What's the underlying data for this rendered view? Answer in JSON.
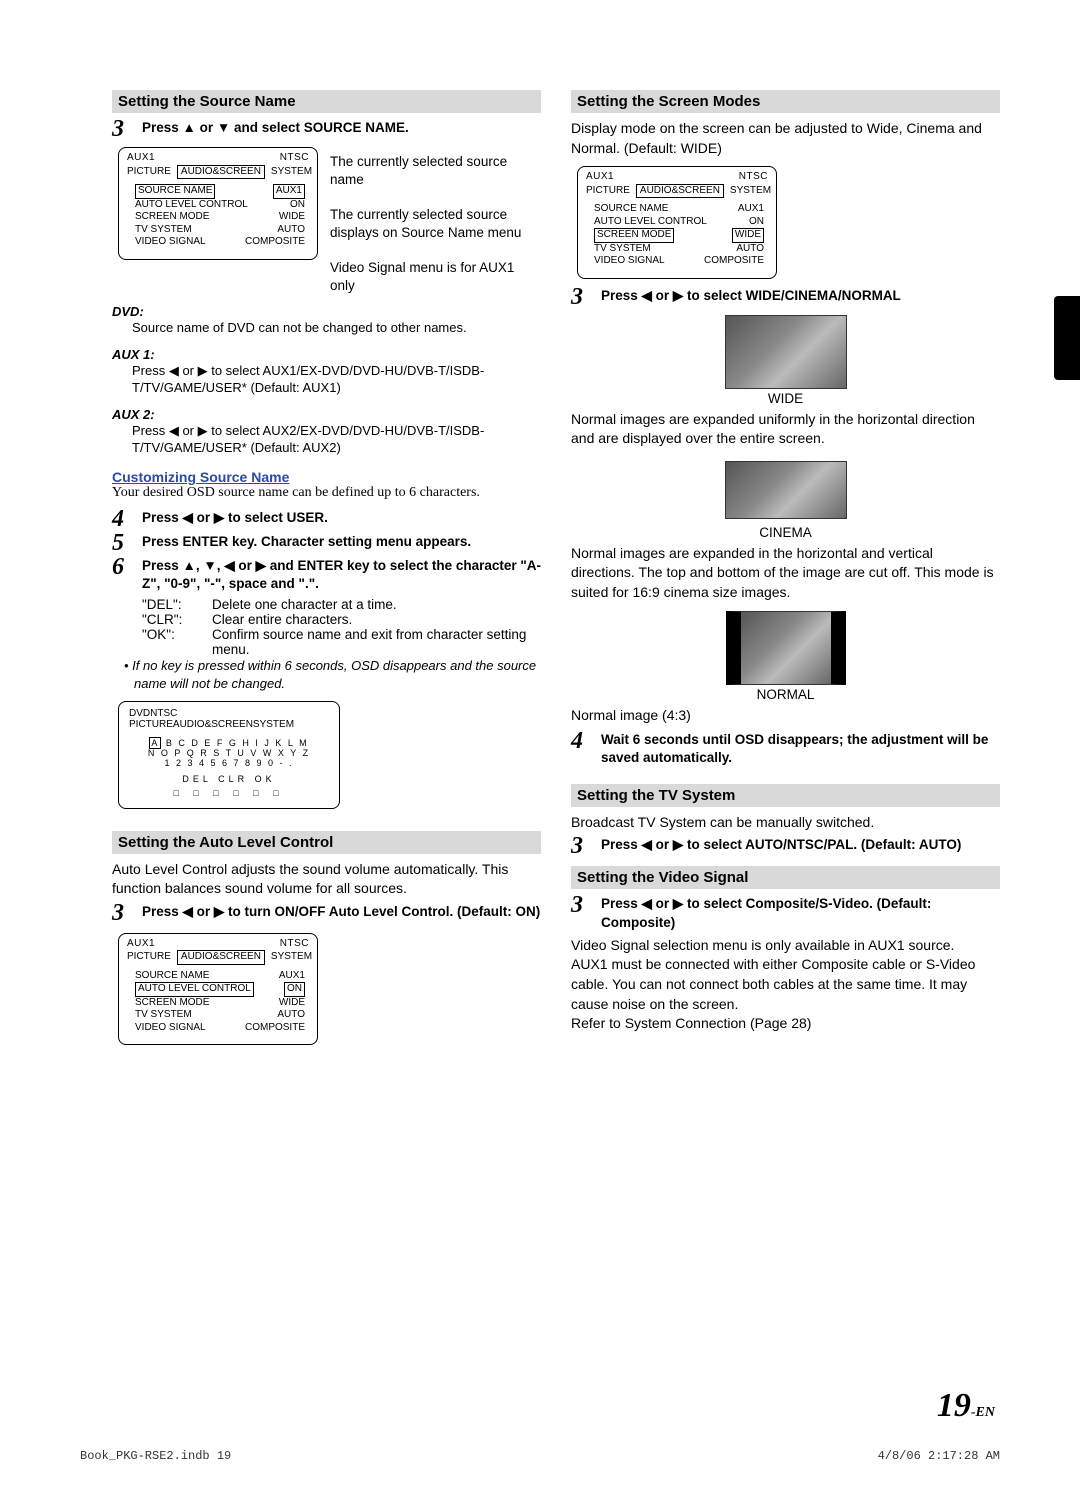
{
  "left": {
    "h1": "Setting the Source Name",
    "s3": "Press  ▲ or ▼ and select SOURCE NAME.",
    "osd1": {
      "title": "AUX1",
      "tv": "NTSC",
      "tabs": [
        "PICTURE",
        "AUDIO&SCREEN",
        "SYSTEM"
      ],
      "rows": [
        {
          "l": "SOURCE NAME",
          "r": "AUX1",
          "hlL": true,
          "hlR": true
        },
        {
          "l": "AUTO LEVEL CONTROL",
          "r": "ON"
        },
        {
          "l": "SCREEN MODE",
          "r": "WIDE"
        },
        {
          "l": "TV SYSTEM",
          "r": "AUTO"
        },
        {
          "l": "VIDEO SIGNAL",
          "r": "COMPOSITE"
        }
      ]
    },
    "cap1": "The currently selected source name",
    "cap2": "The currently selected source displays on Source Name menu",
    "cap3": "Video Signal menu is for AUX1 only",
    "dvd_h": "DVD:",
    "dvd_b": "Source name of DVD can not be changed to other names.",
    "aux1_h": "AUX 1:",
    "aux1_b": "Press ◀ or ▶ to select AUX1/EX-DVD/DVD-HU/DVB-T/ISDB-T/TV/GAME/USER* (Default: AUX1)",
    "aux2_h": "AUX 2:",
    "aux2_b": "Press ◀ or ▶ to select AUX2/EX-DVD/DVD-HU/DVB-T/ISDB-T/TV/GAME/USER* (Default: AUX2)",
    "cust_h": "Customizing Source Name",
    "cust_b": "Your desired OSD source name can be defined up to 6 characters.",
    "s4": "Press ◀ or ▶ to select USER.",
    "s5": "Press ENTER key. Character setting menu appears.",
    "s6": "Press ▲, ▼, ◀ or ▶ and ENTER key to select the character \"A-Z\", \"0-9\", \"-\", space and \".\".",
    "cmds": [
      {
        "k": "\"DEL\":",
        "v": "Delete one character at a time."
      },
      {
        "k": "\"CLR\":",
        "v": "Clear entire characters."
      },
      {
        "k": "\"OK\":",
        "v": "Confirm source name and exit from character setting menu."
      }
    ],
    "note": "If no key is pressed within 6 seconds, OSD disappears and the source name will not be changed.",
    "char_panel": {
      "title": "DVD",
      "tv": "NTSC",
      "tabs": [
        "PICTURE",
        "AUDIO&SCREEN",
        "SYSTEM"
      ],
      "line1": "A B C D E F G H I J K L M",
      "line2": "N O P Q R S T U V W X Y Z",
      "line3": "1 2 3 4 5 6 7 8 9 0 -   .",
      "ops": "DEL   CLR   OK",
      "slots": "□ □ □ □ □ □"
    },
    "h2": "Setting the Auto Level Control",
    "alc_b": "Auto Level Control adjusts the sound volume automatically. This function balances sound volume for all sources.",
    "alc_s3": "Press ◀ or ▶ to turn ON/OFF Auto Level Control. (Default: ON)",
    "osd2": {
      "title": "AUX1",
      "tv": "NTSC",
      "tabs": [
        "PICTURE",
        "AUDIO&SCREEN",
        "SYSTEM"
      ],
      "rows": [
        {
          "l": "SOURCE NAME",
          "r": "AUX1"
        },
        {
          "l": "AUTO LEVEL CONTROL",
          "r": "ON",
          "hlL": true,
          "hlR": true
        },
        {
          "l": "SCREEN MODE",
          "r": "WIDE"
        },
        {
          "l": "TV SYSTEM",
          "r": "AUTO"
        },
        {
          "l": "VIDEO SIGNAL",
          "r": "COMPOSITE"
        }
      ]
    }
  },
  "right": {
    "h1": "Setting the Screen Modes",
    "b1": "Display mode on the screen can be adjusted to Wide, Cinema and Normal. (Default: WIDE)",
    "osd": {
      "title": "AUX1",
      "tv": "NTSC",
      "tabs": [
        "PICTURE",
        "AUDIO&SCREEN",
        "SYSTEM"
      ],
      "rows": [
        {
          "l": "SOURCE NAME",
          "r": "AUX1"
        },
        {
          "l": "AUTO LEVEL CONTROL",
          "r": "ON"
        },
        {
          "l": "SCREEN MODE",
          "r": "WIDE",
          "hlL": true,
          "hlR": true
        },
        {
          "l": "TV SYSTEM",
          "r": "AUTO"
        },
        {
          "l": "VIDEO SIGNAL",
          "r": "COMPOSITE"
        }
      ]
    },
    "s3": "Press ◀ or ▶ to select WIDE/CINEMA/NORMAL",
    "wide_l": "WIDE",
    "wide_b": "Normal images are expanded uniformly in the horizontal direction and are displayed over the entire screen.",
    "cin_l": "CINEMA",
    "cin_b": "Normal images are expanded in the horizontal and vertical directions. The top and bottom of the image are cut off. This mode is suited for 16:9 cinema size images.",
    "nor_l": "NORMAL",
    "nor_b": "Normal image (4:3)",
    "s4": "Wait 6 seconds until OSD disappears; the adjustment will be saved automatically.",
    "h2": "Setting the TV System",
    "tv_b": "Broadcast TV System can be manually switched.",
    "tv_s3": "Press  ◀ or ▶ to select AUTO/NTSC/PAL. (Default: AUTO)",
    "h3": "Setting the Video Signal",
    "vs_s3": "Press  ◀ or ▶ to select Composite/S-Video. (Default: Composite)",
    "vs_b": "Video Signal selection menu is only available in AUX1 source.\nAUX1 must be connected with either Composite cable or S-Video cable. You can not connect both cables at the same time. It may cause noise on the screen.\nRefer to System Connection (Page 28)"
  },
  "page": {
    "num": "19",
    "suf": "-EN"
  },
  "footer": {
    "l": "Book_PKG-RSE2.indb   19",
    "r": "4/8/06   2:17:28  AM"
  }
}
